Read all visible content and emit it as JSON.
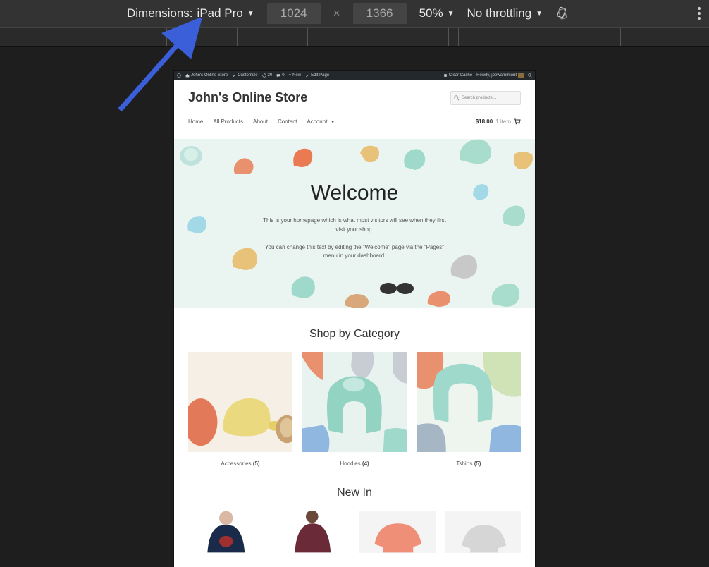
{
  "devtools": {
    "dimensions_label": "Dimensions:",
    "device_name": "iPad Pro",
    "width": "1024",
    "height": "1366",
    "separator": "×",
    "zoom": "50%",
    "throttling": "No throttling"
  },
  "wp_admin_bar": {
    "site_name": "John's Online Store",
    "customize": "Customize",
    "updates_count": "20",
    "comments_count": "0",
    "new_label": "New",
    "edit_page": "Edit Page",
    "clear_cache": "Clear Cache",
    "howdy": "Howdy, joewarnimont"
  },
  "site": {
    "title": "John's Online Store",
    "search_placeholder": "Search products…",
    "nav": {
      "items": [
        "Home",
        "All Products",
        "About",
        "Contact",
        "Account"
      ]
    },
    "cart": {
      "amount": "$18.00",
      "count_label": "1 item"
    },
    "hero": {
      "title": "Welcome",
      "line1": "This is your homepage which is what most visitors will see when they first visit your shop.",
      "line2": "You can change this text by editing the \"Welcome\" page via the \"Pages\" menu in your dashboard."
    },
    "shop_by_category": {
      "heading": "Shop by Category",
      "items": [
        {
          "name": "Accessories",
          "count": "(5)"
        },
        {
          "name": "Hoodies",
          "count": "(4)"
        },
        {
          "name": "Tshirts",
          "count": "(5)"
        }
      ]
    },
    "new_in": {
      "heading": "New In"
    }
  }
}
